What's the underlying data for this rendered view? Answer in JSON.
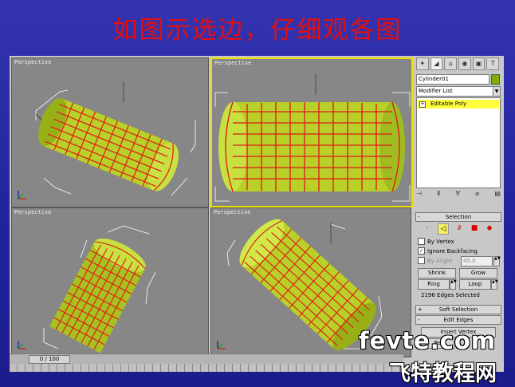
{
  "slide": {
    "title": "如图示选边，仔细观各图"
  },
  "viewports": [
    {
      "label": "Perspective"
    },
    {
      "label": "Perspective"
    },
    {
      "label": "Perspective"
    },
    {
      "label": "Perspective"
    }
  ],
  "command_panel": {
    "tab_icons": [
      "create-icon",
      "modify-icon",
      "hierarchy-icon",
      "motion-icon",
      "display-icon",
      "utilities-icon"
    ],
    "object_name": "Cylinder01",
    "object_color": "#7fb000",
    "modifier_list": "Modifier List",
    "stack_item": "Editable Poly",
    "selection": {
      "title": "Selection",
      "by_vertex": "By Vertex",
      "ignore_backfacing": "Ignore Backfacing",
      "ignore_backfacing_checked": true,
      "by_angle": "By Angle:",
      "angle_value": "45.0",
      "shrink": "Shrink",
      "grow": "Grow",
      "ring": "Ring",
      "loop": "Loop",
      "status": "2196 Edges Selected"
    },
    "soft_selection": "Soft Selection",
    "edit_edges": "Edit Edges",
    "insert_vertex": "Insert Vertex",
    "remove_partial": "Re"
  },
  "timeline": {
    "slider": "0 / 100"
  },
  "watermark": {
    "line1": "fevte.com",
    "line2": "飞特教程网"
  },
  "colors": {
    "slide_bg": "#2a2a9a",
    "title": "#e01010",
    "mesh": "#b8d028",
    "edges": "#e01818",
    "active_border": "#f0e000"
  }
}
